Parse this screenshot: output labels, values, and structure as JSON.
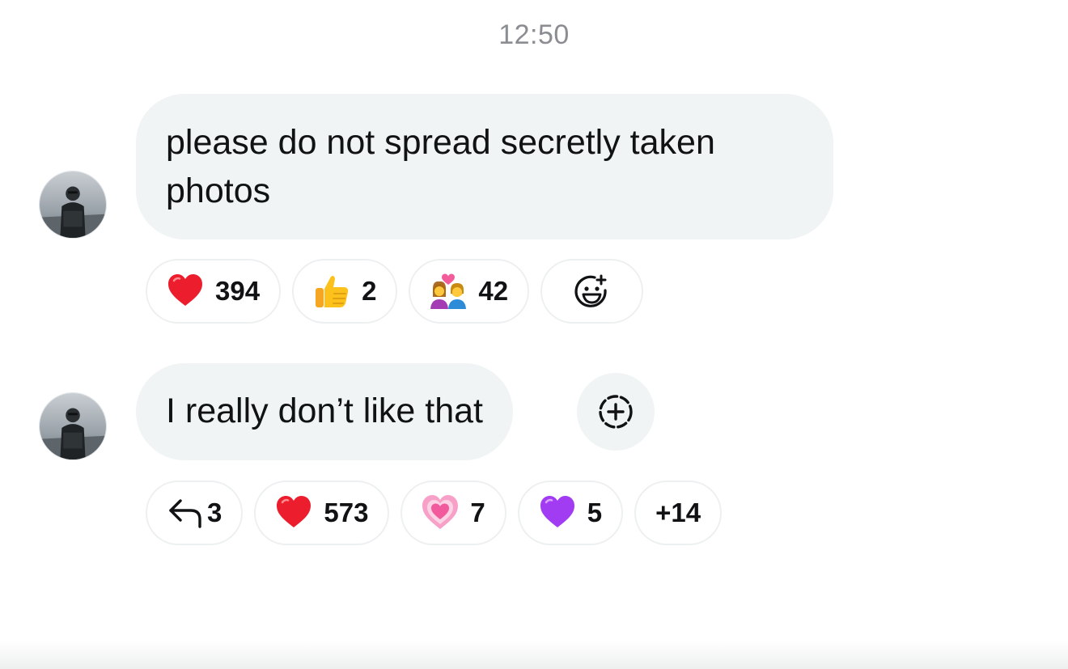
{
  "timestamp": "12:50",
  "messages": [
    {
      "text": "please do not spread secretly taken photos",
      "reactions": [
        {
          "icon": "red-heart-icon",
          "count": "394"
        },
        {
          "icon": "thumbs-up-icon",
          "count": "2"
        },
        {
          "icon": "couple-with-heart-icon",
          "count": "42"
        }
      ]
    },
    {
      "text": "I really don’t like that",
      "reply_count": "3",
      "reactions": [
        {
          "icon": "red-heart-icon",
          "count": "573"
        },
        {
          "icon": "growing-heart-icon",
          "count": "7"
        },
        {
          "icon": "purple-heart-icon",
          "count": "5"
        }
      ],
      "more_reactions": "+14"
    }
  ],
  "colors": {
    "bubble": "#f0f4f4",
    "text": "#101214",
    "timestamp": "#8a8d91",
    "pill_border": "#edf0f1"
  }
}
